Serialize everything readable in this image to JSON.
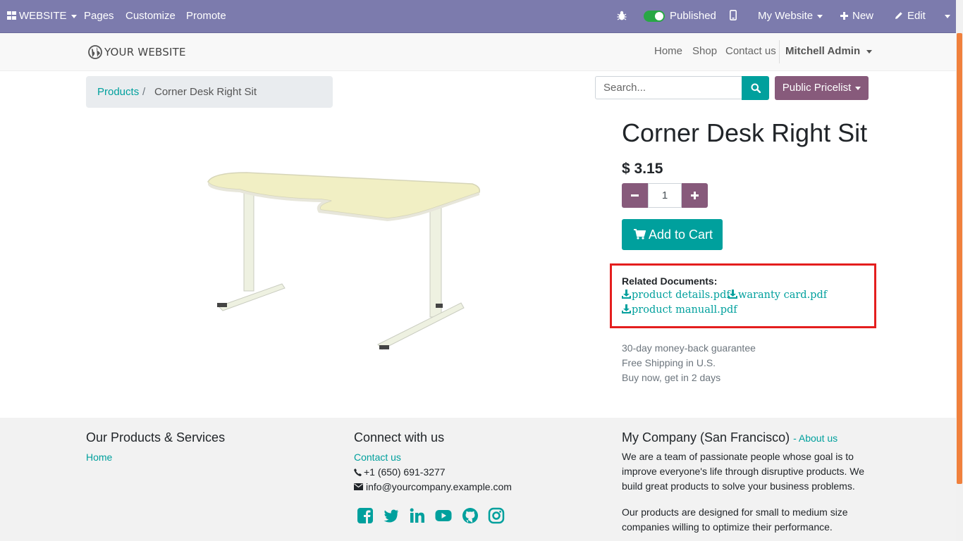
{
  "adminbar": {
    "website": "WEBSITE",
    "pages": "Pages",
    "customize": "Customize",
    "promote": "Promote",
    "published": "Published",
    "my_website": "My Website",
    "new": "New",
    "edit": "Edit"
  },
  "header": {
    "logo": "YOUR WEBSITE",
    "nav": [
      "Home",
      "Shop",
      "Contact us"
    ],
    "user": "Mitchell Admin"
  },
  "breadcrumb": {
    "link": "Products",
    "separator": "/",
    "current": "Corner Desk Right Sit"
  },
  "search": {
    "placeholder": "Search..."
  },
  "pricelist": "Public Pricelist",
  "product": {
    "title": "Corner Desk Right Sit",
    "price": "$ 3.15",
    "quantity": "1",
    "add_to_cart": "Add to Cart"
  },
  "documents": {
    "heading": "Related Documents:",
    "files": [
      "product details.pdf",
      "waranty card.pdf",
      "product manuall.pdf"
    ]
  },
  "guarantee": [
    "30-day money-back guarantee",
    "Free Shipping in U.S.",
    "Buy now, get in 2 days"
  ],
  "footer": {
    "col1": {
      "heading": "Our Products & Services",
      "link": "Home"
    },
    "col2": {
      "heading": "Connect with us",
      "link": "Contact us",
      "phone": "+1 (650) 691-3277",
      "email": "info@yourcompany.example.com"
    },
    "col3": {
      "heading": "My Company (San Francisco)",
      "about": "About us",
      "para1": "We are a team of passionate people whose goal is to improve everyone's life through disruptive products. We build great products to solve your business problems.",
      "para2": "Our products are designed for small to medium size companies willing to optimize their performance."
    },
    "social": [
      "facebook-icon",
      "twitter-icon",
      "linkedin-icon",
      "youtube-icon",
      "github-icon",
      "instagram-icon"
    ]
  },
  "colors": {
    "adminbar": "#7c7bad",
    "accent": "#00a09d",
    "secondary": "#875a7b",
    "highlight": "#e41e1e"
  }
}
